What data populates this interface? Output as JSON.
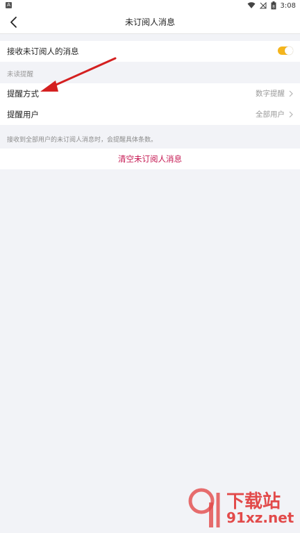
{
  "status_bar": {
    "notification_icon": "A",
    "time": "3:08",
    "battery_level": "8",
    "icons": [
      "wifi-icon",
      "signal-icon",
      "battery-icon"
    ]
  },
  "header": {
    "title": "未订阅人消息",
    "back_icon": "chevron-left-icon"
  },
  "receive_row": {
    "label": "接收未订阅人的消息",
    "toggle_on": true,
    "toggle_color": "#f5b51c"
  },
  "unread_section": {
    "title": "未读提醒"
  },
  "reminder_method_row": {
    "label": "提醒方式",
    "value": "数字提醒"
  },
  "reminder_users_row": {
    "label": "提醒用户",
    "value": "全部用户"
  },
  "hint_text": "接收到全部用户的未订阅人消息时，会提醒具体条数。",
  "clear_button": {
    "label": "清空未订阅人消息",
    "color": "#c4134e"
  },
  "annotation_arrow_color": "#d42020",
  "watermark": {
    "brand": "下载站",
    "domain": "91xz.net"
  }
}
